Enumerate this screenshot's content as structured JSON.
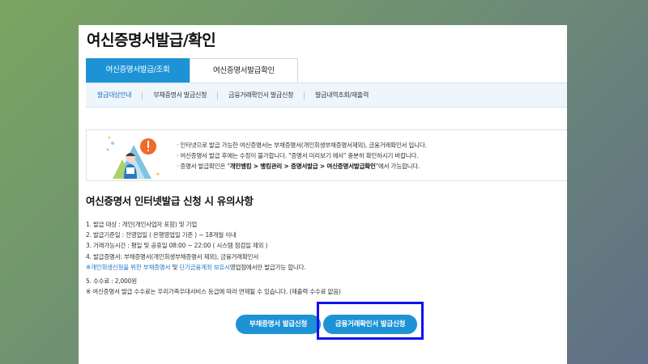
{
  "page": {
    "title": "여신증명서발급/확인"
  },
  "tabs": [
    {
      "label": "여신증명서발급/조회",
      "active": true
    },
    {
      "label": "여신증명서발급확인",
      "active": false
    }
  ],
  "subnav": [
    "발급대상안내",
    "부채증명서 발급신청",
    "금융거래확인서 발급신청",
    "발급내역조회/재출력"
  ],
  "info": {
    "line1": "인터넷으로 발급 가능한 여신증명서는 부채증명서(개인회생부채증명서제외), 금융거래확인서 입니다.",
    "line2": "여신증명서 발급 후에는 수정이 불가합니다. \"증명서 미리보기 에서\" 충분히 확인하시기 바랍니다.",
    "line3_prefix": "증명서 발급확인은 \"",
    "line3_path": "개인뱅킹 > 뱅킹관리 > 증명서발급 > 여신증명서발급확인",
    "line3_suffix": "\"에서 가능합니다."
  },
  "section": {
    "title": "여신증명서 인터넷발급 신청 시 유의사항",
    "n1": "1. 발급 대상 : 개인(개인사업자 포함) 및 기업",
    "n2": "2. 발급기준일 : 전영업일 ( 은행영업일 기준 ) ~ 18개월 이내",
    "n3": "3. 거래가능시간 : 평일 및 공휴일 08:00 ~ 22:00 ( 시스템 점검일 제외 )",
    "n4": "4. 발급증명서: 부채증명서(개인회생부채증명서 제외), 금융거래확인서",
    "n4_note_a": "※개인회생신청을 위한 부채증명서",
    "n4_note_and": " 및 ",
    "n4_note_b": "단기금융계좌 보유시",
    "n4_note_c": "영업점에서만 발급가능 합니다.",
    "n5": "5. 수수료 : 2,000원",
    "n5_note": "※ 여신증명서 발급 수수료는 우리가족우대서비스 등급에 따라 면제될 수 있습니다. (재출력 수수료 없음)"
  },
  "buttons": {
    "debt": "부채증명서 발급신청",
    "fin": "금융거래확인서 발급신청"
  },
  "colors": {
    "accent": "#1d93d6",
    "highlight": "#1111ee"
  }
}
